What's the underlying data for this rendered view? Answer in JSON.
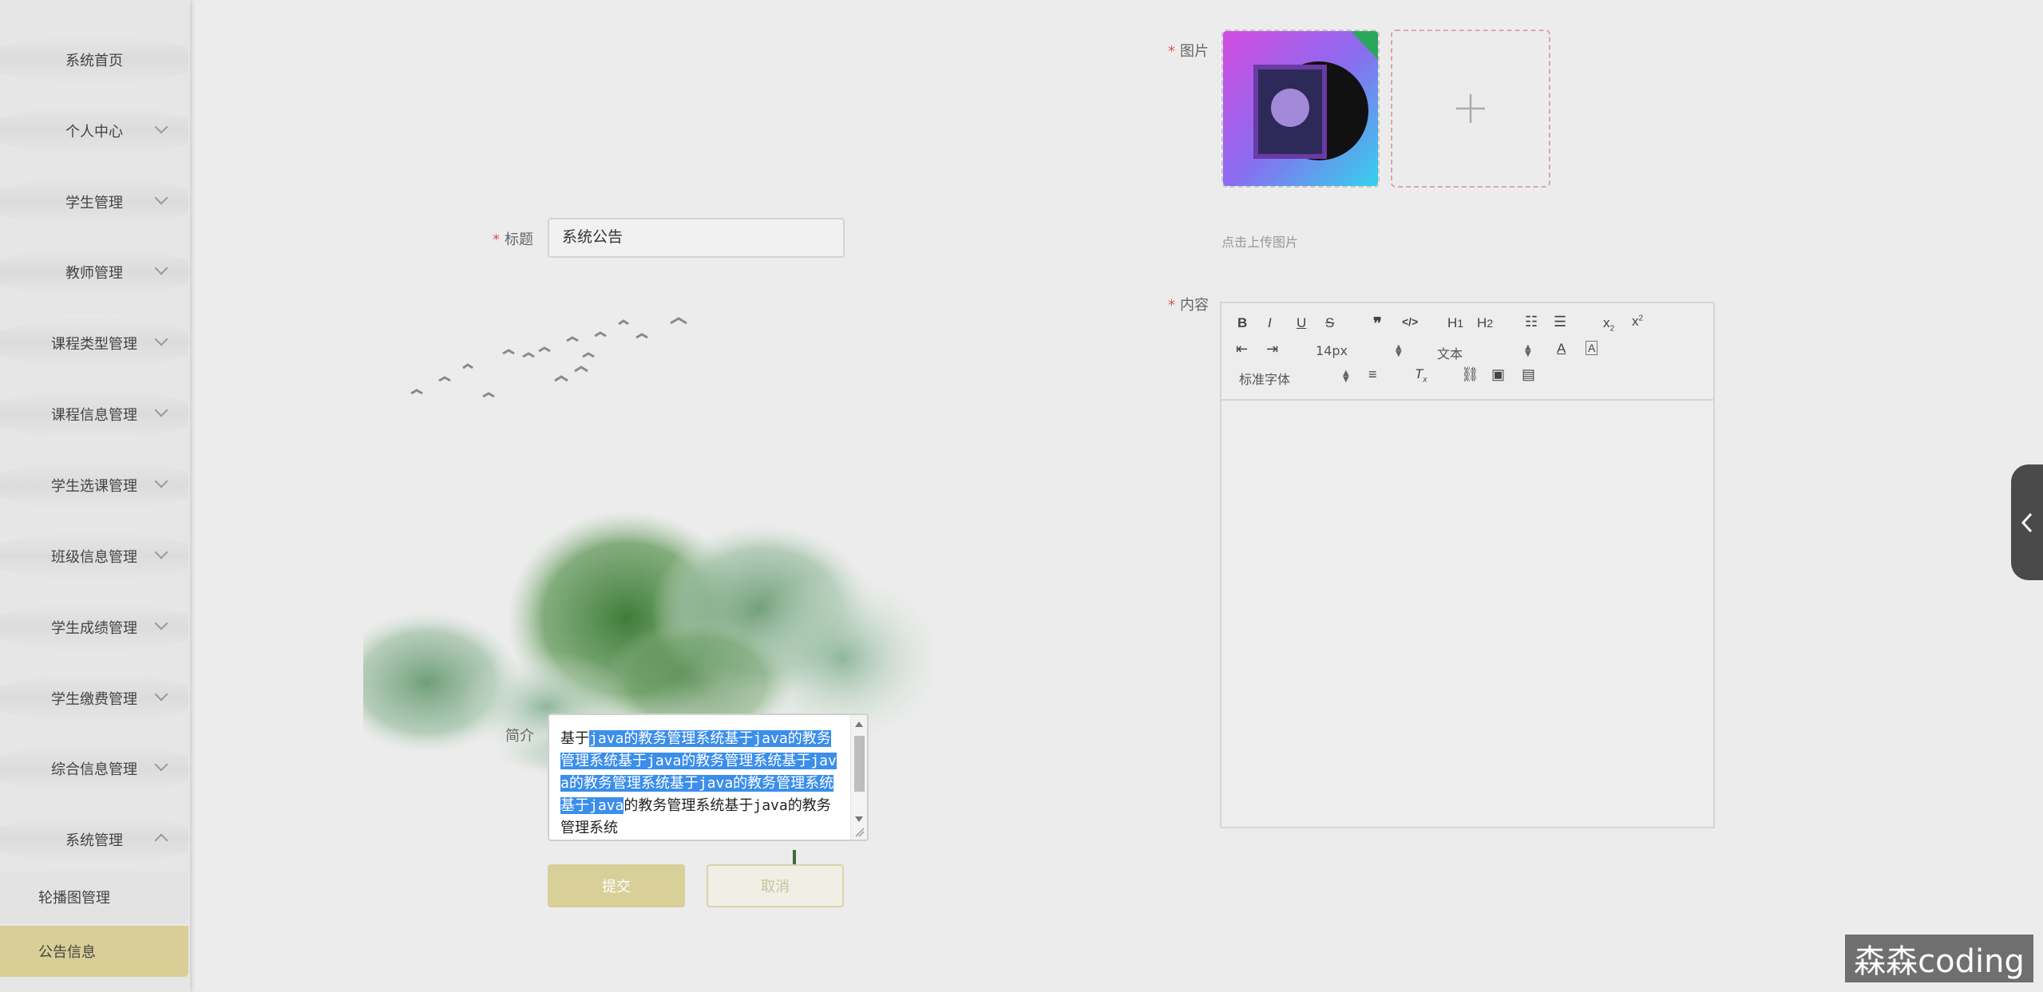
{
  "sidebar": {
    "items": [
      {
        "label": "系统首页",
        "has_chevron": false
      },
      {
        "label": "个人中心",
        "has_chevron": true
      },
      {
        "label": "学生管理",
        "has_chevron": true
      },
      {
        "label": "教师管理",
        "has_chevron": true
      },
      {
        "label": "课程类型管理",
        "has_chevron": true
      },
      {
        "label": "课程信息管理",
        "has_chevron": true
      },
      {
        "label": "学生选课管理",
        "has_chevron": true
      },
      {
        "label": "班级信息管理",
        "has_chevron": true
      },
      {
        "label": "学生成绩管理",
        "has_chevron": true
      },
      {
        "label": "学生缴费管理",
        "has_chevron": true
      },
      {
        "label": "综合信息管理",
        "has_chevron": true
      },
      {
        "label": "系统管理",
        "has_chevron": true,
        "expanded": true
      }
    ],
    "sub_items": [
      {
        "label": "轮播图管理",
        "active": false
      },
      {
        "label": "公告信息",
        "active": true
      }
    ],
    "active_color": "#d9cf96"
  },
  "form": {
    "title_label": "标题",
    "title_value": "系统公告",
    "intro_label": "简介",
    "intro_text": {
      "before": "基于",
      "selected": "java的教务管理系统基于java的教务管理系统基于java的教务管理系统基于java的教务管理系统基于java的教务管理系统基于java",
      "after": "的教务管理系统基于java的教务管理系统"
    },
    "image_label": "图片",
    "upload_hint": "点击上传图片",
    "content_label": "内容",
    "submit_label": "提交",
    "cancel_label": "取消"
  },
  "editor": {
    "font_size": "14px",
    "text_style": "文本",
    "font_family": "标准字体"
  },
  "colors": {
    "accent": "#d8cf99",
    "required": "#e05555",
    "selection": "#3b8eea"
  },
  "watermark": "森森coding"
}
